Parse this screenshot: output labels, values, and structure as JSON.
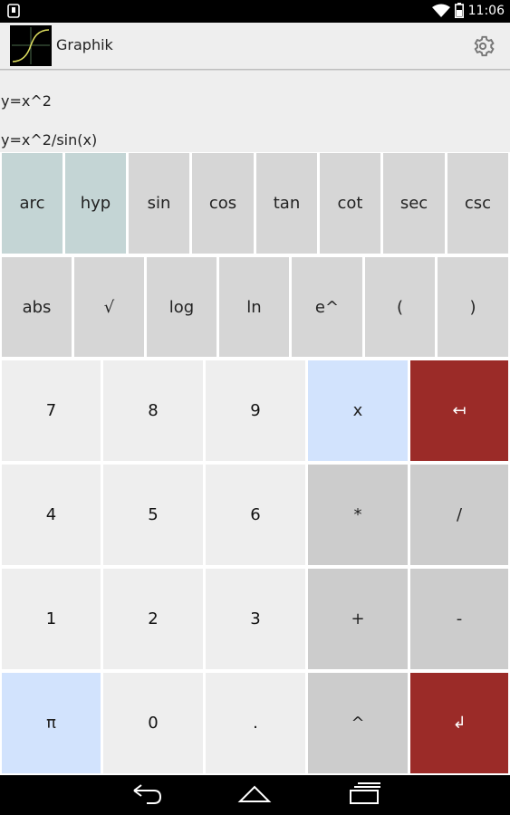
{
  "status_bar": {
    "time": "11:06"
  },
  "app": {
    "title": "Graphik"
  },
  "formulas": [
    "y=x^2",
    "y=x^2/sin(x)"
  ],
  "function_keys_row1": [
    "arc",
    "hyp",
    "sin",
    "cos",
    "tan",
    "cot",
    "sec",
    "csc"
  ],
  "function_keys_row2": [
    "abs",
    "√",
    "log",
    "ln",
    "e^",
    "(",
    ")"
  ],
  "keypad": {
    "r1": [
      "7",
      "8",
      "9",
      "x",
      "↤"
    ],
    "r2": [
      "4",
      "5",
      "6",
      "*",
      "/"
    ],
    "r3": [
      "1",
      "2",
      "3",
      "+",
      "-"
    ],
    "r4": [
      "π",
      "0",
      ".",
      "^",
      "↲"
    ]
  },
  "colors": {
    "function_key": "#d6d6d6",
    "function_key_active": "#c4d5d5",
    "number_key": "#eeeeee",
    "variable_key": "#d2e3fd",
    "operator_key": "#cccccc",
    "action_key": "#9b2b28"
  },
  "icons": {
    "notification": "sim-notification-icon",
    "wifi": "wifi-icon",
    "battery": "battery-icon",
    "settings": "gear-icon",
    "back": "back-icon",
    "home": "home-icon",
    "recents": "recents-icon"
  }
}
